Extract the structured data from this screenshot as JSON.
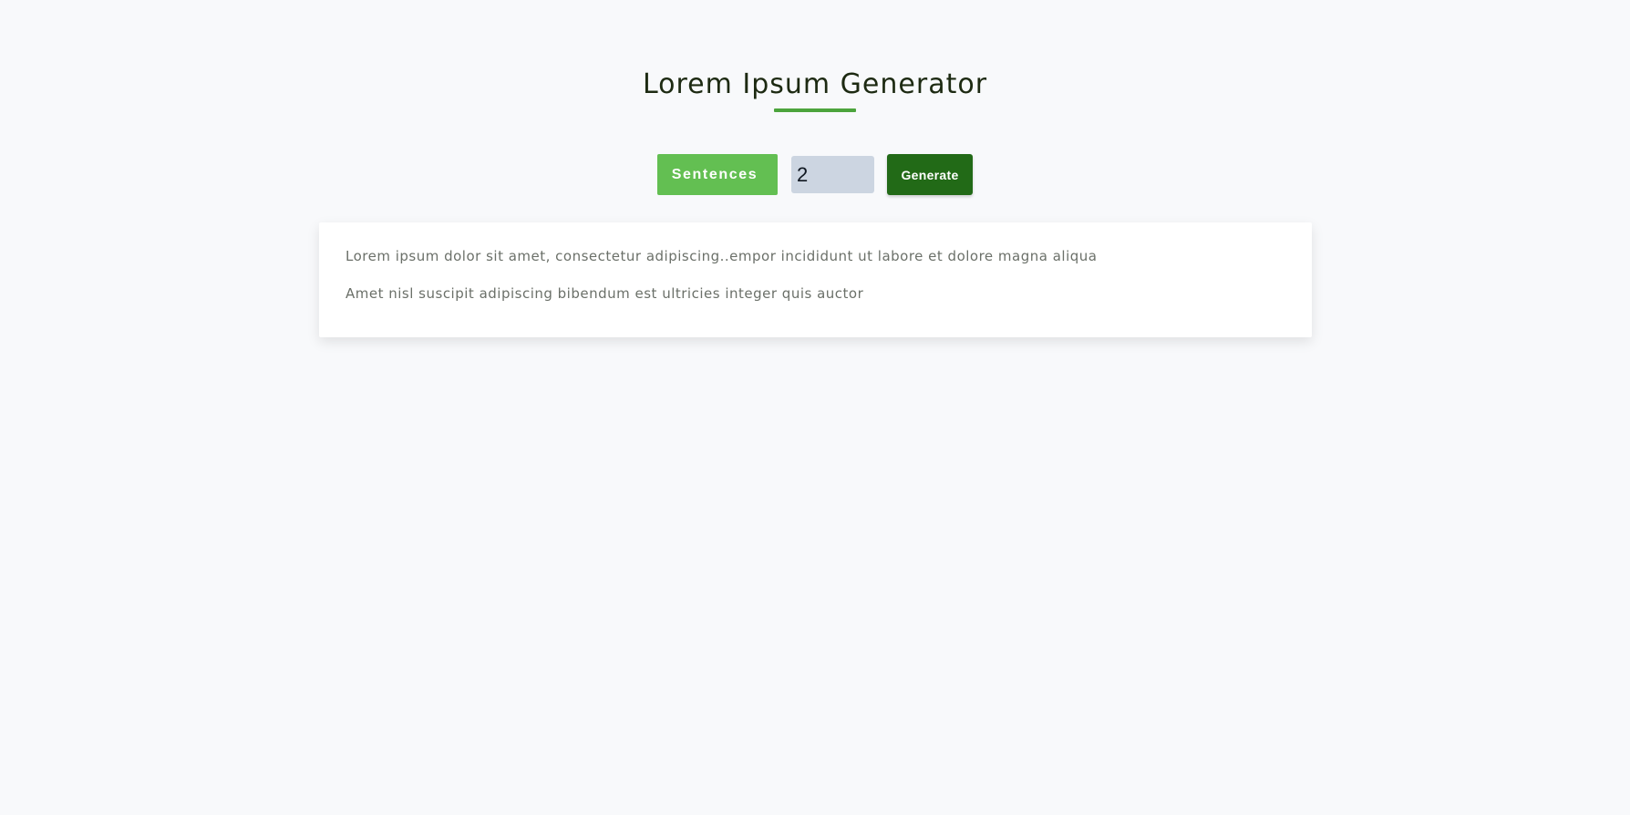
{
  "header": {
    "title": "Lorem Ipsum Generator",
    "accent_color": "#4ca43c"
  },
  "controls": {
    "type_selector": {
      "selected": "Sentences",
      "color": "#63bf52"
    },
    "count_input": {
      "value": "2"
    },
    "generate_button": {
      "label": "Generate",
      "color": "#226a17"
    }
  },
  "result": {
    "paragraphs": [
      "Lorem ipsum dolor sit amet, consectetur adipiscing..empor incididunt ut labore et dolore magna aliqua",
      "Amet nisl suscipit adipiscing bibendum est ultricies integer quis auctor"
    ]
  }
}
